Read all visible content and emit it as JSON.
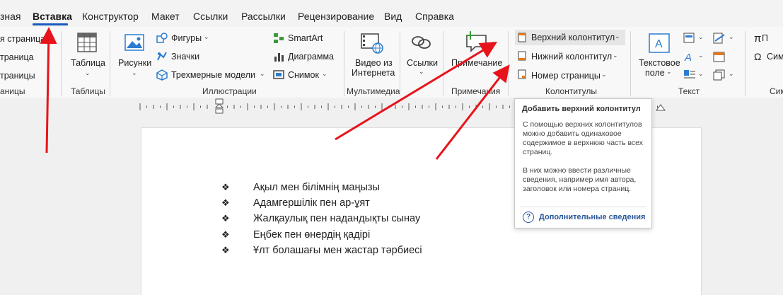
{
  "tabs": {
    "home_partial": "зная",
    "insert": "Вставка",
    "design": "Конструктор",
    "layout": "Макет",
    "references": "Ссылки",
    "mailings": "Рассылки",
    "review": "Рецензирование",
    "view": "Вид",
    "help": "Справка"
  },
  "ribbon": {
    "pages": {
      "items": [
        "я страница",
        "траница",
        "траницы"
      ],
      "group_label": "аницы"
    },
    "tables": {
      "table_label": "Таблица",
      "group_label": "Таблицы"
    },
    "illustrations": {
      "pictures_label": "Рисунки",
      "shapes_label": "Фигуры",
      "icons_label": "Значки",
      "models_label": "Трехмерные модели",
      "smartart_label": "SmartArt",
      "chart_label": "Диаграмма",
      "screenshot_label": "Снимок",
      "group_label": "Иллюстрации"
    },
    "media": {
      "video_line1": "Видео из",
      "video_line2": "Интернета",
      "group_label": "Мультимедиа"
    },
    "links": {
      "label": "Ссылки"
    },
    "comments": {
      "comment_label": "Примечание",
      "group_label": "Примечания"
    },
    "header_footer": {
      "header_label": "Верхний колонтитул",
      "footer_label": "Нижний колонтитул",
      "page_number_label": "Номер страницы",
      "group_label": "Колонтитулы"
    },
    "text": {
      "textbox_line1": "Текстовое",
      "textbox_line2": "поле",
      "group_label": "Текст"
    },
    "symbols": {
      "equation_partial": "П",
      "symbol_partial": "Сим",
      "group_label_partial": "Сим"
    }
  },
  "tooltip": {
    "title": "Добавить верхний колонтитул",
    "paragraph1": "С помощью верхних колонтитулов можно добавить одинаковое содержимое в верхнюю часть всех страниц.",
    "paragraph2": "В них можно ввести различные сведения, например имя автора, заголовок или номера страниц.",
    "link": "Дополнительные сведения"
  },
  "document": {
    "bullet_glyph": "❖",
    "items": [
      "Ақыл мен білімнің маңызы",
      "Адамгершілік пен ар-ұят",
      "Жалқаулық пен надандықты сынау",
      "Еңбек пен өнердің қадірі",
      "Ұлт болашағы мен жастар тәрбиесі"
    ]
  },
  "colors": {
    "accent": "#185abd",
    "arrow": "#e8141b",
    "link": "#2b579a"
  }
}
